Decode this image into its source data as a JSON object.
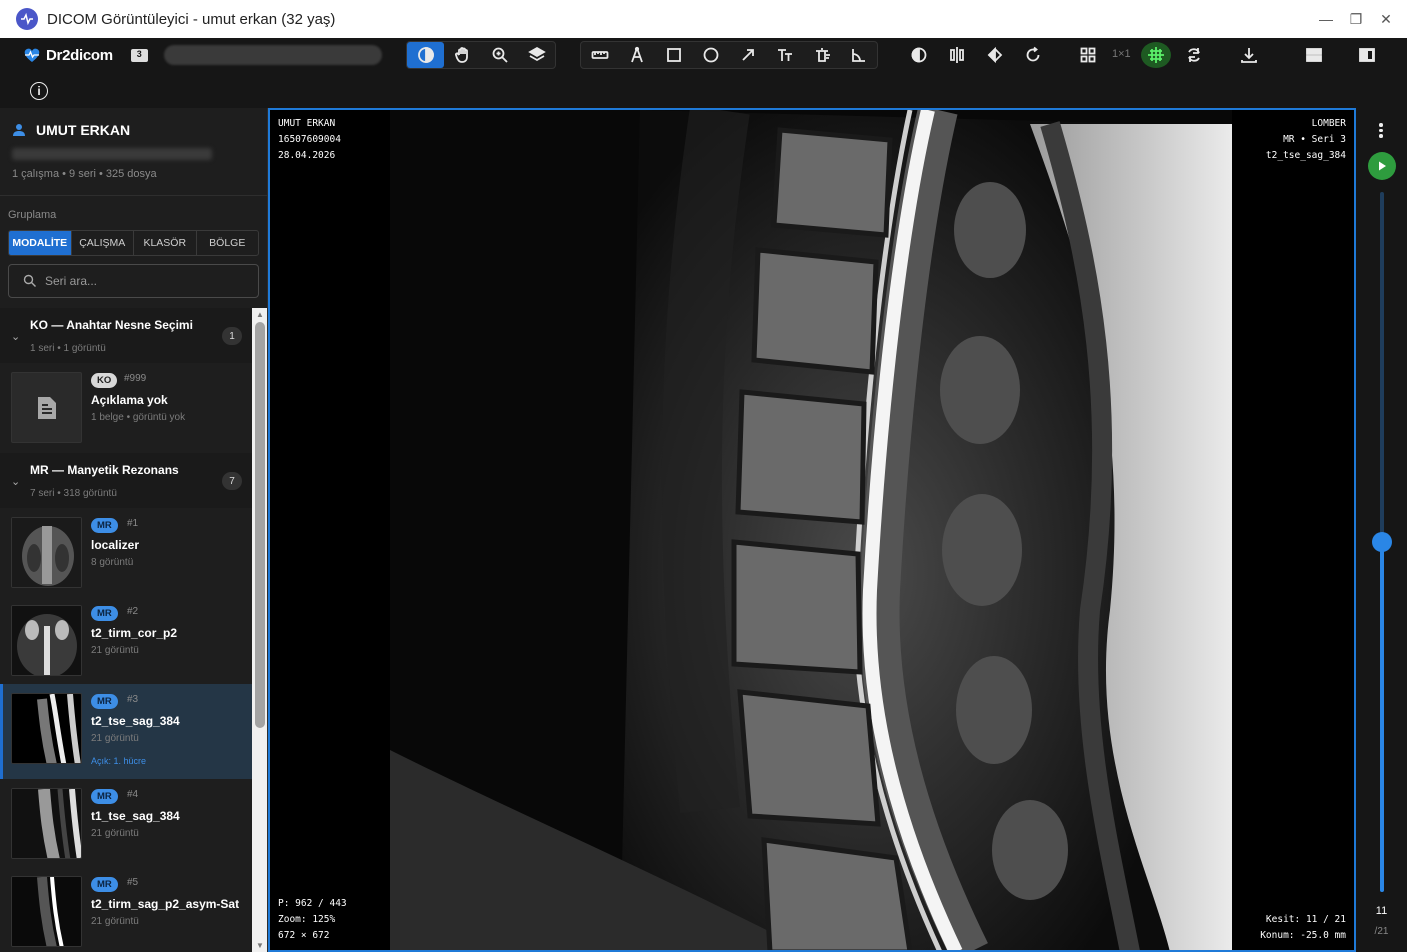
{
  "window": {
    "title": "DICOM Görüntüleyici - umut erkan (32 yaş)"
  },
  "toolbar": {
    "brand": "Dr2dicom",
    "folder_count": "3",
    "layout_label": "1×1"
  },
  "sidebar": {
    "patient_name": "UMUT ERKAN",
    "patient_stats": "1 çalışma • 9 seri • 325 dosya",
    "grouping_label": "Gruplama",
    "grouping_tabs": [
      "MODALİTE",
      "ÇALIŞMA",
      "KLASÖR",
      "BÖLGE"
    ],
    "search_placeholder": "Seri ara...",
    "groups": [
      {
        "title": "KO — Anahtar Nesne Seçimi",
        "sub": "1 seri • 1 görüntü",
        "count": "1",
        "items": [
          {
            "badge": "KO",
            "num": "#999",
            "title": "Açıklama yok",
            "sub": "1 belge • görüntü yok"
          }
        ]
      },
      {
        "title": "MR — Manyetik Rezonans",
        "sub": "7 seri • 318 görüntü",
        "count": "7",
        "items": [
          {
            "badge": "MR",
            "num": "#1",
            "title": "localizer",
            "sub": "8 görüntü"
          },
          {
            "badge": "MR",
            "num": "#2",
            "title": "t2_tirm_cor_p2",
            "sub": "21 görüntü"
          },
          {
            "badge": "MR",
            "num": "#3",
            "title": "t2_tse_sag_384",
            "sub": "21 görüntü",
            "open": "Açık: 1. hücre"
          },
          {
            "badge": "MR",
            "num": "#4",
            "title": "t1_tse_sag_384",
            "sub": "21 görüntü"
          },
          {
            "badge": "MR",
            "num": "#5",
            "title": "t2_tirm_sag_p2_asym-Sat",
            "sub": "21 görüntü"
          }
        ]
      }
    ]
  },
  "viewer": {
    "top_left": [
      "UMUT ERKAN",
      "16507609004",
      "28.04.2026"
    ],
    "top_right": [
      "LOMBER",
      "MR • Seri 3",
      "t2_tse_sag_384"
    ],
    "bottom_left": [
      "P: 962 / 443",
      "Zoom: 125%",
      "672 × 672"
    ],
    "bottom_right": [
      "Kesit: 11 / 21",
      "Konum: -25.0 mm"
    ]
  },
  "slider": {
    "current": "11",
    "total": "/21",
    "position_fraction": 0.5
  },
  "colors": {
    "accent": "#1f6fd1",
    "play": "#2e9c3e",
    "viewer_border": "#1f7ad8"
  }
}
